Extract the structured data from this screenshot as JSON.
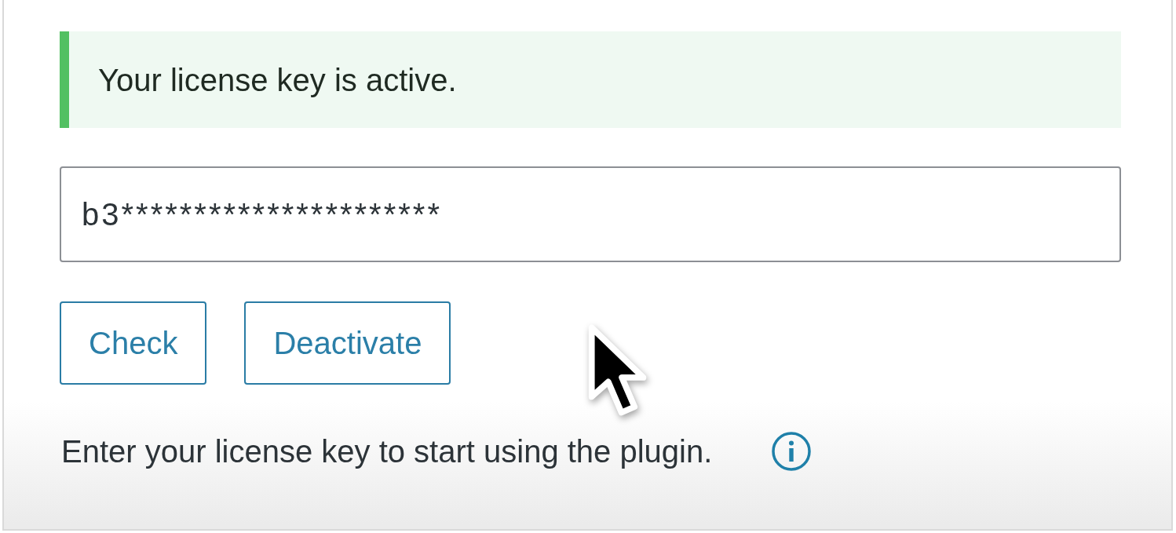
{
  "notice": {
    "kind": "success",
    "message": "Your license key is active."
  },
  "license_field": {
    "value": "b3**********************"
  },
  "buttons": [
    {
      "label": "Check"
    },
    {
      "label": "Deactivate"
    }
  ],
  "description": {
    "text": "Enter your license key to start using the plugin."
  }
}
